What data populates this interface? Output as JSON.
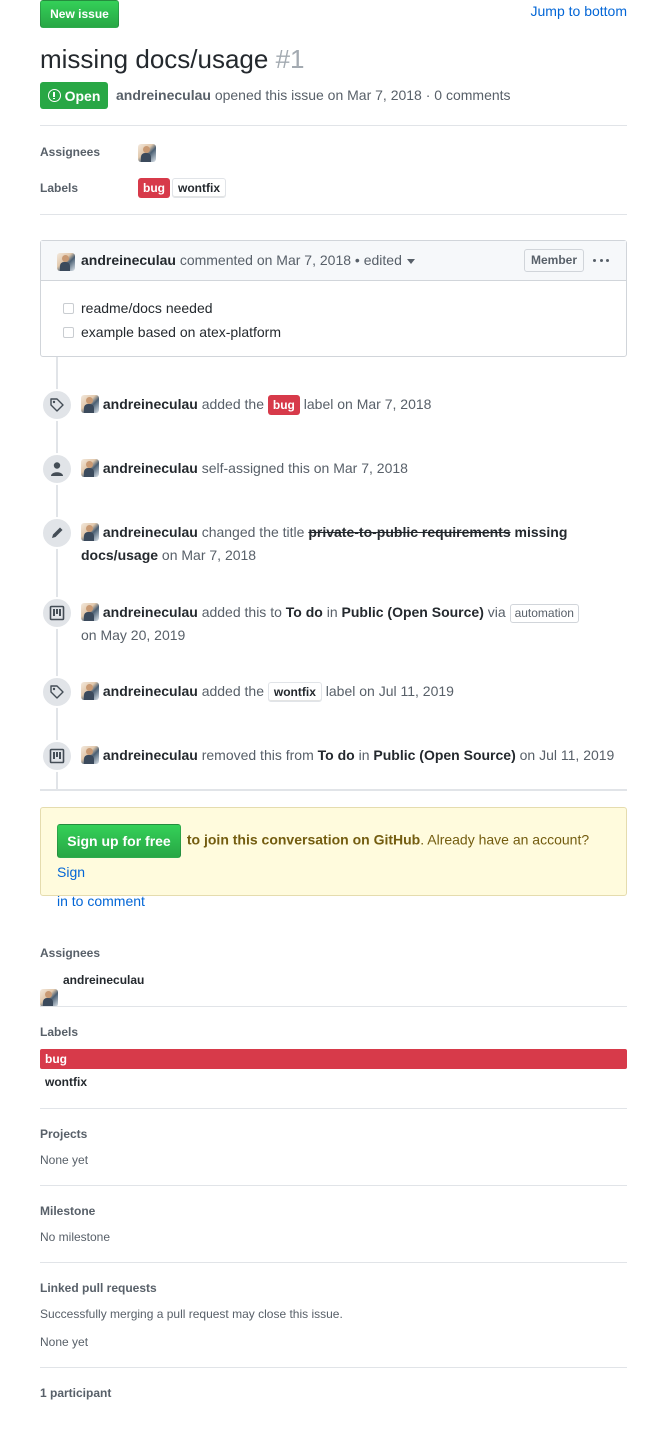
{
  "header": {
    "new_issue_label": "New issue",
    "jump_label": "Jump to bottom"
  },
  "issue": {
    "title": "missing docs/usage",
    "number": "#1",
    "state_label": "Open",
    "author": "andreineculau",
    "opened_text": "opened this issue on Mar 7, 2018 · 0 comments"
  },
  "meta": {
    "assignees_label": "Assignees",
    "labels_label": "Labels",
    "labels": [
      {
        "name": "bug",
        "color": "#d73a4a"
      },
      {
        "name": "wontfix",
        "color": "#ffffff"
      }
    ]
  },
  "comment": {
    "author": "andreineculau",
    "action": "commented on Mar 7, 2018",
    "edited": "• edited",
    "role_badge": "Member",
    "more_icon": "kebab-horizontal-icon",
    "tasks": [
      "readme/docs needed",
      "example based on atex-platform"
    ]
  },
  "timeline": [
    {
      "icon": "tag-icon",
      "user": "andreineculau",
      "pre": "added the",
      "label": "bug",
      "post": "label on Mar 7, 2018"
    },
    {
      "icon": "person-icon",
      "user": "andreineculau",
      "text": "self-assigned this on Mar 7, 2018"
    },
    {
      "icon": "pencil-icon",
      "user": "andreineculau",
      "pre": "changed the title",
      "old_title": "private-to-public requirements",
      "new_title": "missing docs/usage",
      "post": "on Mar 7, 2018"
    },
    {
      "icon": "project-icon",
      "user": "andreineculau",
      "pre": "added this to",
      "column": "To do",
      "in": "in",
      "project": "Public (Open Source)",
      "via": "via",
      "badge": "automation",
      "post": "on May 20, 2019"
    },
    {
      "icon": "tag-icon",
      "user": "andreineculau",
      "pre": "added the",
      "label": "wontfix",
      "post": "label on Jul 11, 2019"
    },
    {
      "icon": "project-icon",
      "user": "andreineculau",
      "pre": "removed this from",
      "column": "To do",
      "in": "in",
      "project": "Public (Open Source)",
      "post": "on Jul 11, 2019"
    }
  ],
  "signup": {
    "button": "Sign up for free",
    "bold_text": "to join this conversation on GitHub",
    "rest_text": ". Already have an account?",
    "signin_link_1": "Sign",
    "signin_link_2": "in to comment",
    "bg_color": "#fffbdd"
  },
  "sidebar": {
    "assignees_head": "Assignees",
    "assignee_name": "andreineculau",
    "labels_head": "Labels",
    "label_bug": "bug",
    "label_wontfix": "wontfix",
    "projects_head": "Projects",
    "projects_value": "None yet",
    "milestone_head": "Milestone",
    "milestone_value": "No milestone",
    "linked_head": "Linked pull requests",
    "linked_desc": "Successfully merging a pull request may close this issue.",
    "linked_value": "None yet",
    "participants_head": "1 participant"
  }
}
